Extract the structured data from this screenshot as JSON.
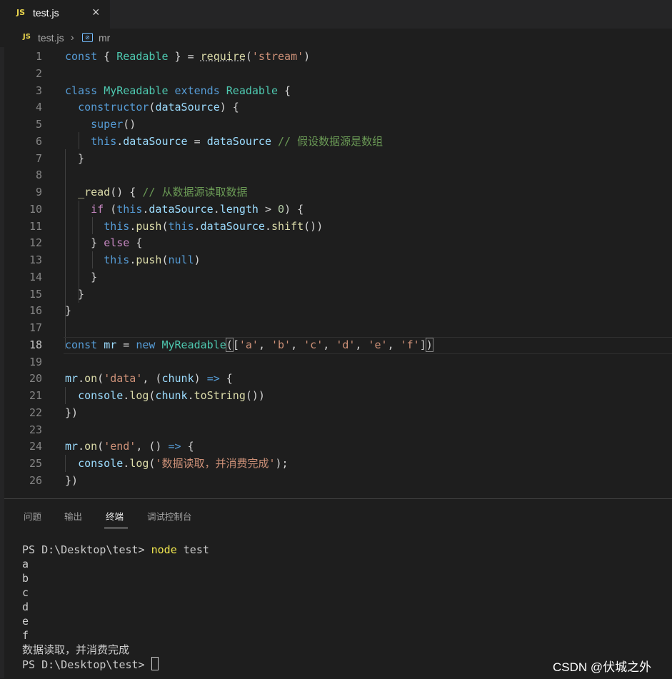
{
  "tab": {
    "icon": "js-file-icon",
    "icon_text": "JS",
    "title": "test.js",
    "close": "×"
  },
  "breadcrumb": {
    "icon_text": "JS",
    "file": "test.js",
    "separator": "›",
    "symbol_icon": "variable-symbol-icon",
    "symbol_text": "[⊘]",
    "symbol": "mr"
  },
  "editor": {
    "current_line": 18,
    "line_numbers": [
      "1",
      "2",
      "3",
      "4",
      "5",
      "6",
      "7",
      "8",
      "9",
      "10",
      "11",
      "12",
      "13",
      "14",
      "15",
      "16",
      "17",
      "18",
      "19",
      "20",
      "21",
      "22",
      "23",
      "24",
      "25",
      "26"
    ],
    "tokens": {
      "const": "const",
      "Readable": "Readable",
      "require": "require",
      "stream": "'stream'",
      "class": "class",
      "MyReadable": "MyReadable",
      "extends": "extends",
      "constructor": "constructor",
      "dataSource": "dataSource",
      "super": "super",
      "this": "this",
      "comment6": "// 假设数据源是数组",
      "read": "_read",
      "comment9": "// 从数据源读取数据",
      "if": "if",
      "length": "length",
      "zero": "0",
      "push": "push",
      "shift": "shift",
      "else": "else",
      "null": "null",
      "mr": "mr",
      "new": "new",
      "a": "'a'",
      "b": "'b'",
      "c": "'c'",
      "d": "'d'",
      "e": "'e'",
      "f": "'f'",
      "on": "on",
      "data_evt": "'data'",
      "chunk": "chunk",
      "arrow": "=>",
      "console": "console",
      "log": "log",
      "toString": "toString",
      "end_evt": "'end'",
      "done_msg": "'数据读取，并消费完成'"
    }
  },
  "panel": {
    "tabs": [
      "问题",
      "输出",
      "终端",
      "调试控制台"
    ],
    "active_tab": "终端",
    "terminal": {
      "prompt": "PS D:\\Desktop\\test>",
      "command": "node",
      "argument": "test",
      "output": [
        "a",
        "b",
        "c",
        "d",
        "e",
        "f",
        "数据读取，并消费完成"
      ]
    }
  },
  "watermark": "CSDN @伏城之外"
}
